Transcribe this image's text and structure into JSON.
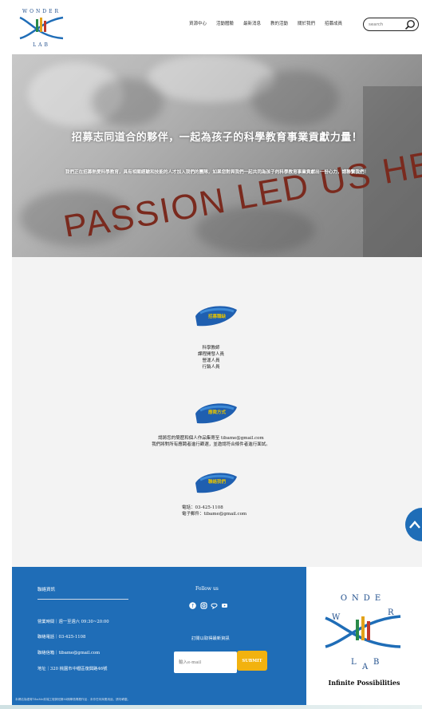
{
  "header": {
    "nav": [
      "資源中心",
      "活動體驗",
      "最新消息",
      "教的活動",
      "關於我們",
      "招募成員"
    ],
    "search_placeholder": "search"
  },
  "logo": {
    "top_letters": "W O N D E R",
    "bottom_text": "L A B"
  },
  "hero": {
    "heading": "招募志同道合的夥伴，一起為孩子的科學教育事業貢獻力量！",
    "subheading": "我們正在招募熱愛科學教育，具有相關經驗和技能的人才加入我們的團隊，如果您對與我們一起共同為孩子的科學教育事業貢獻出一份心力，請聯繫我們！",
    "sign_text": "PASSION LED US HERE"
  },
  "sections": {
    "brush1_label": "招募職缺",
    "positions": [
      "科學教師",
      "課程開發人員",
      "營運人員",
      "行銷人員"
    ],
    "brush2_label": "應徵方式",
    "apply_lines": [
      "請將您的簡歷和個人作品集寄至 tibame@gmail.com",
      "我們將對所有應聘者進行篩選，並邀請符合條件者進行面試。"
    ],
    "brush3_label": "聯絡我們",
    "contact_lines": [
      "電話：03-425-1108",
      "電子郵件：tibame@gmail.com"
    ]
  },
  "footer": {
    "title": "聯絡資訊",
    "hours": "營業時間｜週一至週六 09:30~20:00",
    "phone": "聯絡電話｜03-425-1108",
    "email": "聯絡信箱｜tibame@gmail.com",
    "address": "地址｜320 桃園市中壢區復興路46號",
    "follow": "Follow us",
    "subscribe_title": "訂閱以取得最新資訊",
    "email_placeholder": "輸入e-mail",
    "submit": "SUBMIT",
    "copyright": "本網站為緯育TibaMe前端工程師班第84期學員專題作品．未作任何商業用途，請勿轉載。"
  },
  "brand": {
    "tagline": "Infinite Possibilities"
  },
  "colors": {
    "footer_blue": "#1f6db7",
    "accent_yellow": "#f2b20f",
    "brush_blue": "#1f5fb0"
  }
}
